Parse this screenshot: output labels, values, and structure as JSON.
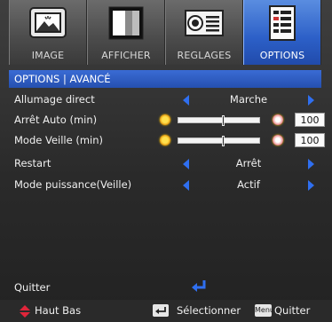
{
  "tabs": [
    {
      "label": "IMAGE",
      "icon": "image-tab-icon",
      "active": false
    },
    {
      "label": "AFFICHER",
      "icon": "display-tab-icon",
      "active": false
    },
    {
      "label": "REGLAGES",
      "icon": "projector-settings-icon",
      "active": false
    },
    {
      "label": "OPTIONS",
      "icon": "options-list-icon",
      "active": true
    }
  ],
  "breadcrumb": "OPTIONS | AVANCÉ",
  "menu": {
    "allumage": {
      "label": "Allumage direct",
      "value": "Marche"
    },
    "arret_auto": {
      "label": "Arrêt Auto (min)",
      "value": "100",
      "fraction": 0.55
    },
    "mode_veille": {
      "label": "Mode Veille (min)",
      "value": "100",
      "fraction": 0.55
    },
    "restart": {
      "label": "Restart",
      "value": "Arrêt"
    },
    "mode_puissance": {
      "label": "Mode puissance(Veille)",
      "value": "Actif"
    },
    "quitter": {
      "label": "Quitter"
    }
  },
  "footer": {
    "nav_label": "Haut Bas",
    "select_label": "Sélectionner",
    "menu_key": "Menu",
    "quit_label": "Quitter"
  },
  "colors": {
    "accent_blue": "#2f6ff0",
    "header_blue": "#2d5cc2",
    "nav_red": "#e0253a"
  }
}
